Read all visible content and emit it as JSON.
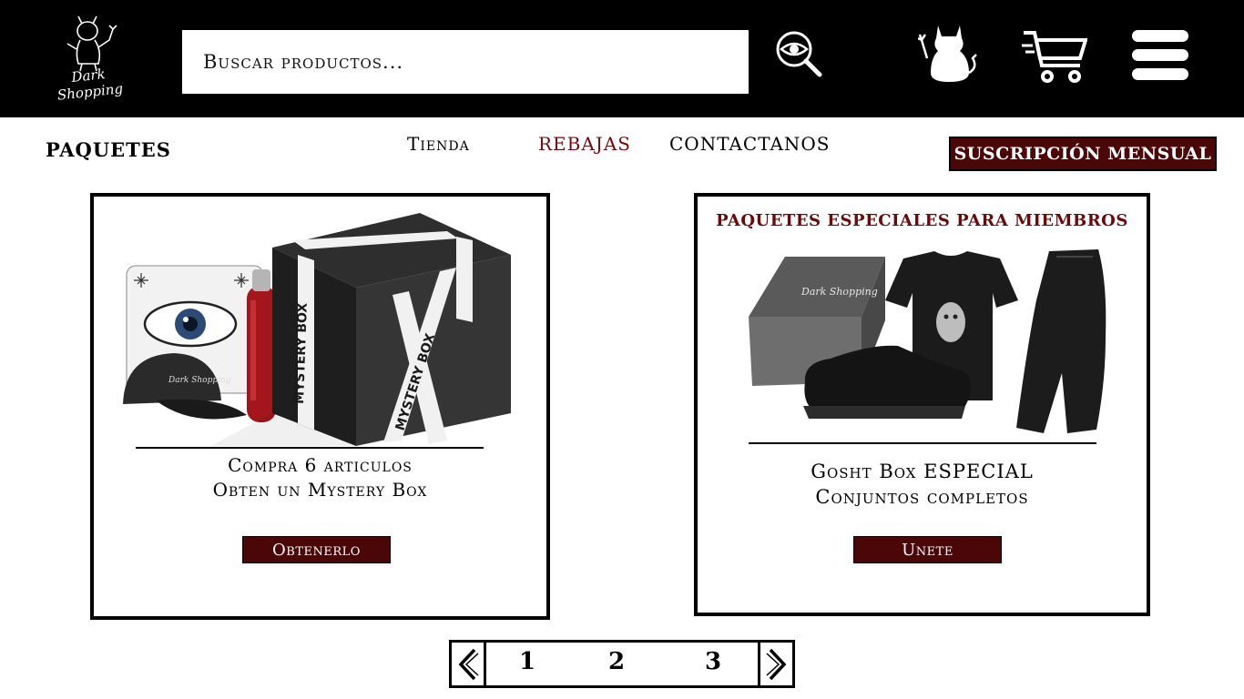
{
  "header": {
    "logo_text": "Dark Shopping",
    "search": {
      "placeholder": "Buscar productos..."
    },
    "icons": [
      "eye-magnifier-search-icon",
      "devil-user-icon",
      "shopping-cart-icon",
      "hamburger-menu-icon"
    ]
  },
  "nav": {
    "section_title": "PAQUETES",
    "links": [
      "Tienda",
      "REBAJAS",
      "CONTACTANOS"
    ],
    "subscription_label": "SUSCRIPCIÓN MENSUAL"
  },
  "cards": [
    {
      "title": "",
      "line1": "Compra 6 articulos",
      "line2": "Obten un Mystery Box",
      "button": "Obtenerlo",
      "box_text": "MYSTERY BOX"
    },
    {
      "title": "PAQUETES ESPECIALES PARA MIEMBROS",
      "line1": "Gosht Box ESPECIAL",
      "line2": "Conjuntos completos",
      "button": "Unete",
      "box_text": "Dark Shopping"
    }
  ],
  "pagination": {
    "pages": [
      "1",
      "2",
      "3"
    ]
  },
  "colors": {
    "header_bg": "#000000",
    "accent": "#4b0608",
    "accent_text": "#7a0a0a"
  }
}
